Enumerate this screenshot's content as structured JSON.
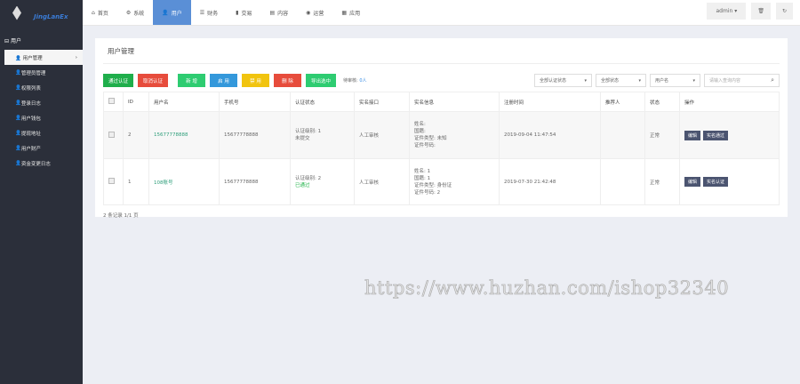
{
  "logo": {
    "text": "JingLanEx"
  },
  "nav": [
    {
      "label": "首页",
      "icon": "home"
    },
    {
      "label": "系统",
      "icon": "gear"
    },
    {
      "label": "用户",
      "icon": "user"
    },
    {
      "label": "财务",
      "icon": "list"
    },
    {
      "label": "交易",
      "icon": "bar-chart"
    },
    {
      "label": "内容",
      "icon": "document"
    },
    {
      "label": "运营",
      "icon": "globe"
    },
    {
      "label": "应用",
      "icon": "grid"
    }
  ],
  "topright": {
    "user": "admin ▾"
  },
  "sidebar": {
    "heading": "用户",
    "items": [
      {
        "label": "用户管理"
      },
      {
        "label": "管理员管理"
      },
      {
        "label": "权限列表"
      },
      {
        "label": "登录日志"
      },
      {
        "label": "用户钱包"
      },
      {
        "label": "提现地址"
      },
      {
        "label": "用户财产"
      },
      {
        "label": "资金变更日志"
      }
    ]
  },
  "page": {
    "title": "用户管理"
  },
  "toolbar": {
    "buttons": [
      {
        "label": "通过认证",
        "color": "#1fae4b"
      },
      {
        "label": "取消认证",
        "color": "#e74c3c"
      },
      {
        "label": "新 增",
        "color": "#2ecc71"
      },
      {
        "label": "启 用",
        "color": "#3498db"
      },
      {
        "label": "禁 用",
        "color": "#f1c40f"
      },
      {
        "label": "删 除",
        "color": "#e74c3c"
      },
      {
        "label": "导出选中",
        "color": "#2ecc71"
      }
    ],
    "pending_label": "待审核:",
    "pending_value": "0人",
    "filters": [
      "全部认证状态",
      "全部状态",
      "用户名"
    ],
    "search_placeholder": "请输入查询内容"
  },
  "table": {
    "headers": [
      "ID",
      "用户名",
      "手机号",
      "认证状态",
      "实名接口",
      "实名信息",
      "注册时间",
      "推荐人",
      "状态",
      "操作"
    ],
    "rows": [
      {
        "id": "2",
        "username": "15677778888",
        "phone": "15677778888",
        "auth_level": "认证级别: 1",
        "auth_state": "未提交",
        "api": "人工审核",
        "info": [
          "姓名:",
          "国籍:",
          "证件类型: 未知",
          "证件号码:"
        ],
        "reg_time": "2019-09-04 11:47:54",
        "referrer": "",
        "status": "正常",
        "actions": [
          "编辑",
          "实名通过"
        ]
      },
      {
        "id": "1",
        "username": "108账号",
        "phone": "15677778888",
        "auth_level": "认证级别: 2",
        "auth_state": "已通过",
        "api": "人工审核",
        "info": [
          "姓名: 1",
          "国籍: 1",
          "证件类型: 身份证",
          "证件号码: 2"
        ],
        "reg_time": "2019-07-30 21:42:48",
        "referrer": "",
        "status": "正常",
        "actions": [
          "编辑",
          "实名认证"
        ]
      }
    ]
  },
  "footer": {
    "summary": "2 条记录 1/1 页"
  },
  "watermark": "https://www.huzhan.com/ishop32340"
}
